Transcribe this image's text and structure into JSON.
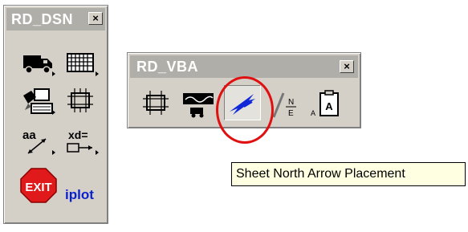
{
  "toolbars": {
    "dsn": {
      "title": "RD_DSN",
      "close_label": "×"
    },
    "vba": {
      "title": "RD_VBA",
      "close_label": "×"
    }
  },
  "tools": {
    "dsn_text_sample": "aa",
    "xd_text": "xd=",
    "exit_label": "EXIT",
    "iplot_label": "iplot",
    "north_letter": "N",
    "east_letter": "E",
    "small_a": "A",
    "box_a": "A"
  },
  "tooltip": {
    "text": "Sheet North Arrow Placement"
  },
  "colors": {
    "toolbar_bg": "#d4d0c8",
    "title_bg": "#b0aea8",
    "highlight": "#e01010",
    "tooltip_bg": "#ffffe1",
    "iplot": "#0a1fd0"
  }
}
